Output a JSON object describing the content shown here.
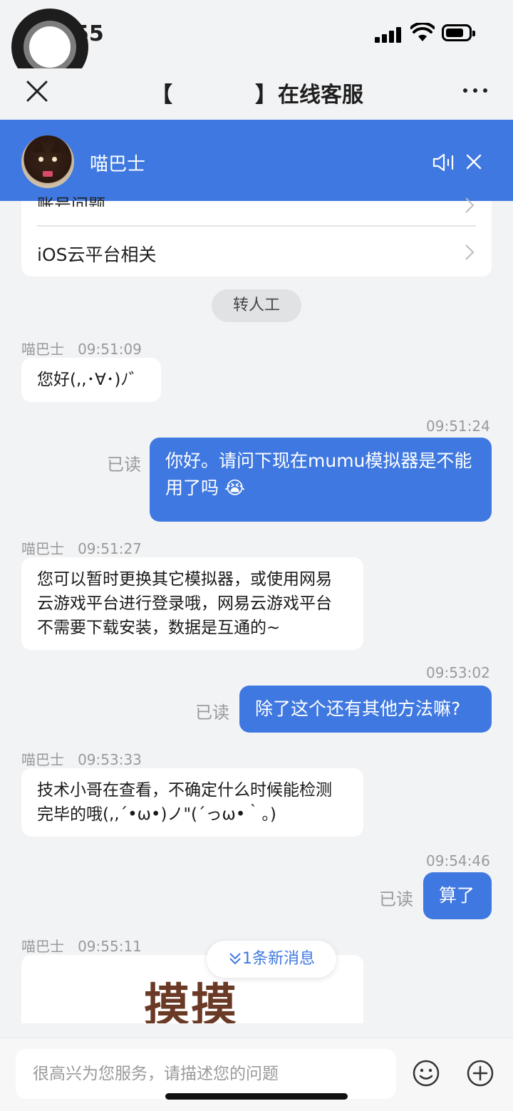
{
  "status": {
    "time": "55"
  },
  "nav": {
    "bracket_open": "【",
    "bracket_close": "】",
    "title": "在线客服"
  },
  "agent": {
    "name": "喵巴士"
  },
  "menu": {
    "partial_label": "账号问题",
    "row_label": "iOS云平台相关"
  },
  "transfer_label": "转人工",
  "messages": {
    "m1": {
      "sender": "喵巴士",
      "time": "09:51:09",
      "text": "您好(,,･∀･)ﾉ゛"
    },
    "m2": {
      "time": "09:51:24",
      "read": "已读",
      "text": "你好。请问下现在mumu模拟器是不能用了吗 😭"
    },
    "m3": {
      "sender": "喵巴士",
      "time": "09:51:27",
      "text": "您可以暂时更换其它模拟器，或使用网易云游戏平台进行登录哦，网易云游戏平台不需要下载安装，数据是互通的~"
    },
    "m4": {
      "time": "09:53:02",
      "read": "已读",
      "text": "除了这个还有其他方法嘛?"
    },
    "m5": {
      "sender": "喵巴士",
      "time": "09:53:33",
      "text": "技术小哥在查看，不确定什么时候能检测完毕的哦(,,´•ω•)ノ\"(´っω•｀。)"
    },
    "m6": {
      "time": "09:54:46",
      "read": "已读",
      "text": "算了"
    },
    "m7": {
      "sender": "喵巴士",
      "time": "09:55:11",
      "image_text": "摸摸"
    }
  },
  "new_message_label": "1条新消息",
  "input": {
    "placeholder": "很高兴为您服务，请描述您的问题"
  },
  "colors": {
    "accent": "#3f78e0",
    "background": "#f2f3f5"
  }
}
